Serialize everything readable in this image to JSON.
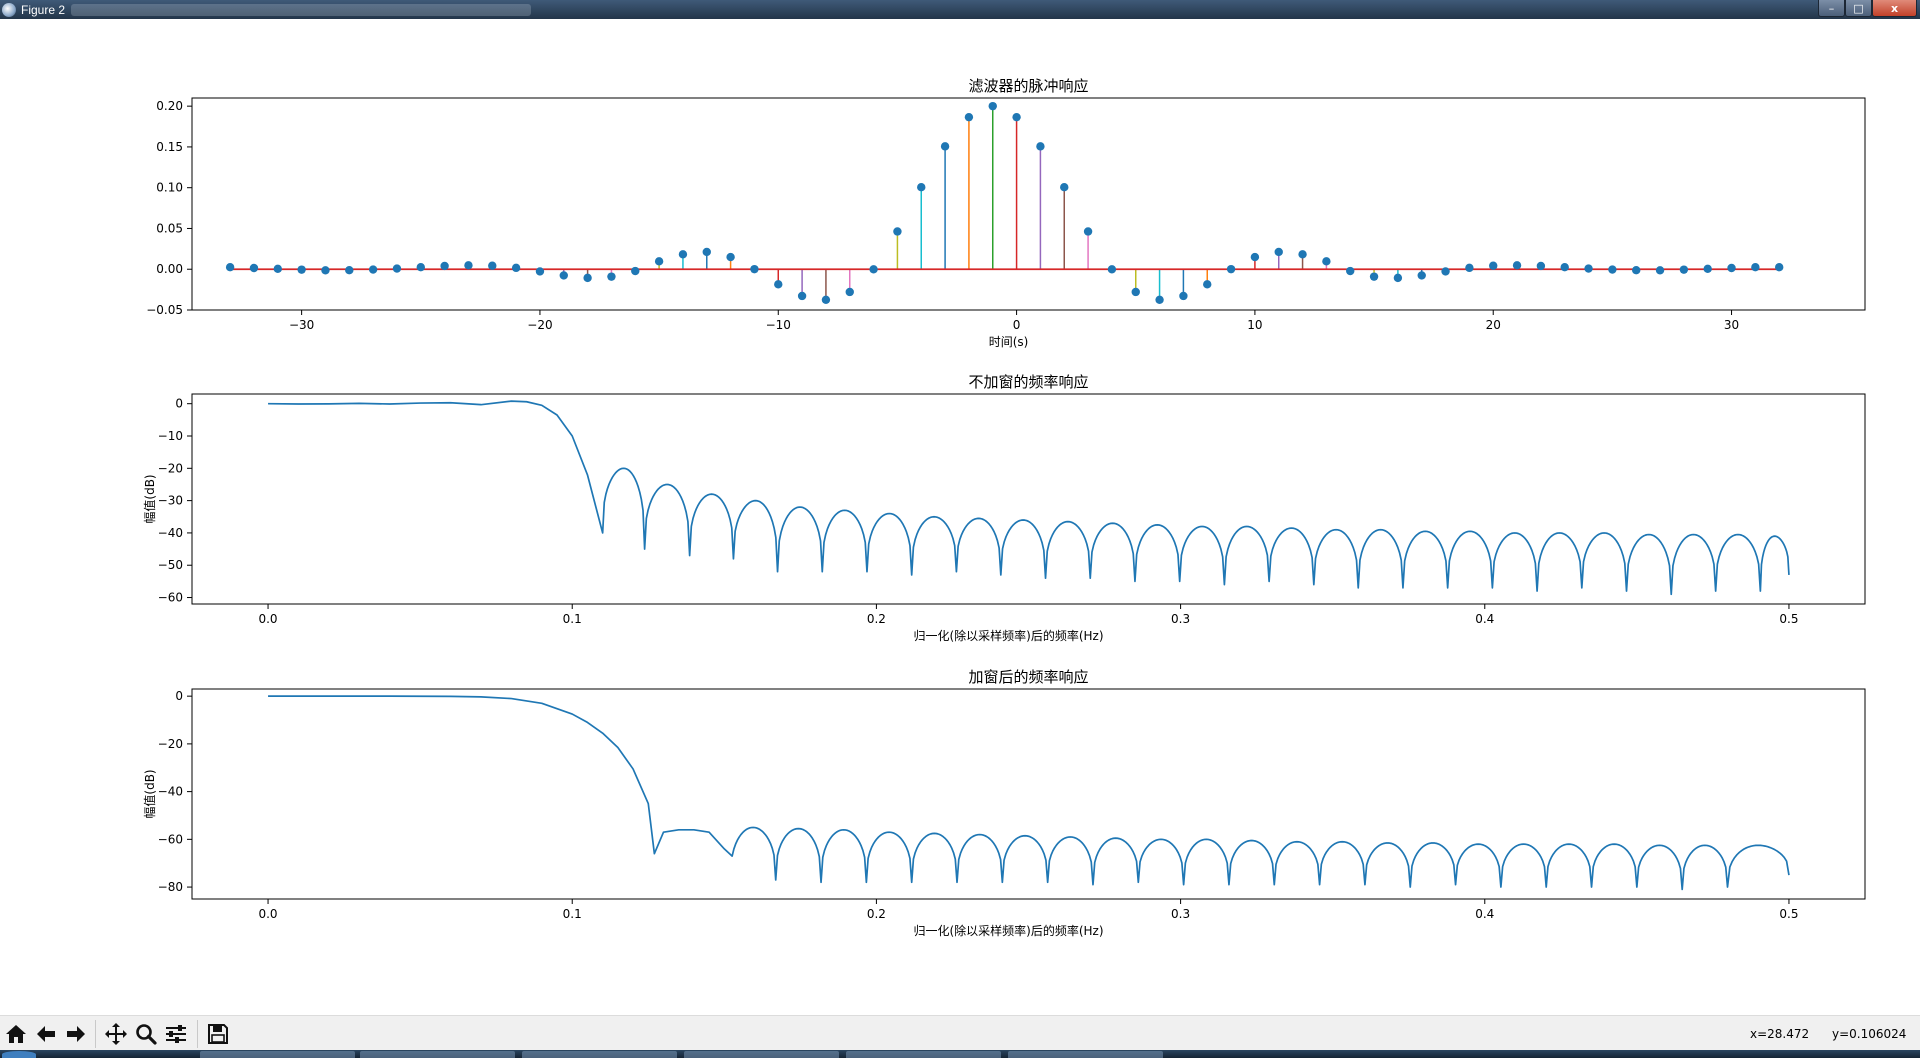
{
  "window": {
    "title": "Figure 2",
    "controls": {
      "minimize": "–",
      "maximize": "□",
      "close": "x"
    }
  },
  "colors": {
    "line": "#1f77b4",
    "marker": "#1f77b4",
    "baseline": "#d62728",
    "stem_cycle": [
      "#1f77b4",
      "#ff7f0e",
      "#2ca02c",
      "#d62728",
      "#9467bd",
      "#8c564b",
      "#e377c2",
      "#7f7f7f",
      "#bcbd22",
      "#17becf"
    ]
  },
  "chart_data": [
    {
      "type": "stem",
      "title": "滤波器的脉冲响应",
      "xlabel": "时间(s)",
      "ylabel": "",
      "xlim": [
        -34.6,
        35.6
      ],
      "ylim": [
        -0.05,
        0.21
      ],
      "xticks": [
        -30,
        -20,
        -10,
        0,
        10,
        20,
        30
      ],
      "xtick_labels": [
        "−30",
        "−20",
        "−10",
        "0",
        "10",
        "20",
        "30"
      ],
      "yticks": [
        -0.05,
        0.0,
        0.05,
        0.1,
        0.15,
        0.2
      ],
      "ytick_labels": [
        "−0.05",
        "0.00",
        "0.05",
        "0.10",
        "0.15",
        "0.20"
      ],
      "x_start": -33,
      "x_step": 1,
      "values": [
        0.0025,
        0.0015,
        0.0005,
        -0.0005,
        -0.0013,
        -0.0012,
        -0.0004,
        0.0008,
        0.0025,
        0.004,
        0.0048,
        0.0043,
        0.0017,
        -0.0027,
        -0.0076,
        -0.0106,
        -0.0091,
        -0.0022,
        0.0097,
        0.0183,
        0.0212,
        0.0149,
        0.0001,
        -0.0185,
        -0.0328,
        -0.0375,
        -0.0279,
        -0.0001,
        0.0463,
        0.1006,
        0.1507,
        0.1865,
        0.2,
        0.1865,
        0.1507,
        0.1006,
        0.0463,
        -0.0001,
        -0.0279,
        -0.0375,
        -0.0328,
        -0.0185,
        0.0001,
        0.0149,
        0.0212,
        0.0183,
        0.0097,
        -0.0022,
        -0.0091,
        -0.0106,
        -0.0076,
        -0.0027,
        0.0017,
        0.0043,
        0.0048,
        0.004,
        0.0025,
        0.0008,
        -0.0004,
        -0.0012,
        -0.0013,
        -0.0005,
        0.0005,
        0.0015,
        0.0025,
        0.0025
      ],
      "grid": false
    },
    {
      "type": "line",
      "title": "不加窗的频率响应",
      "xlabel": "归一化(除以采样频率)后的频率(Hz)",
      "ylabel": "幅值(dB)",
      "xlim": [
        -0.025,
        0.525
      ],
      "ylim": [
        -62,
        3
      ],
      "xticks": [
        0.0,
        0.1,
        0.2,
        0.3,
        0.4,
        0.5
      ],
      "xtick_labels": [
        "0.0",
        "0.1",
        "0.2",
        "0.3",
        "0.4",
        "0.5"
      ],
      "yticks": [
        0,
        -10,
        -20,
        -30,
        -40,
        -50,
        -60
      ],
      "ytick_labels": [
        "0",
        "−10",
        "−20",
        "−30",
        "−40",
        "−50",
        "−60"
      ],
      "passband": {
        "x": [
          0.0,
          0.01,
          0.02,
          0.03,
          0.04,
          0.05,
          0.06,
          0.07,
          0.08,
          0.085,
          0.09,
          0.095,
          0.1,
          0.105,
          0.11
        ],
        "y": [
          0.0,
          -0.1,
          -0.05,
          0.1,
          -0.1,
          0.2,
          0.3,
          -0.3,
          0.8,
          0.6,
          -0.5,
          -3.5,
          -10,
          -22,
          -40
        ]
      },
      "lobe_peaks": [
        -20,
        -25,
        -28,
        -30,
        -32,
        -33,
        -34,
        -35,
        -35.5,
        -36,
        -36.5,
        -37,
        -37.5,
        -38,
        -38,
        -38.5,
        -39,
        -39,
        -39.5,
        -39.5,
        -40,
        -40,
        -40,
        -40.5,
        -40.5,
        -40.5,
        -41,
        -41,
        -41
      ],
      "nulls_x": [
        0.11,
        0.1238,
        0.1386,
        0.153,
        0.1675,
        0.1822,
        0.1969,
        0.2116,
        0.2263,
        0.2409,
        0.2556,
        0.2703,
        0.285,
        0.2997,
        0.3144,
        0.3291,
        0.3438,
        0.3584,
        0.3731,
        0.3878,
        0.4025,
        0.4172,
        0.4319,
        0.4466,
        0.4613,
        0.4759,
        0.4906,
        0.5
      ],
      "nulls_y": [
        -40,
        -45,
        -47,
        -48,
        -52,
        -52,
        -52,
        -53,
        -52,
        -53,
        -54,
        -54,
        -55,
        -55,
        -56,
        -55,
        -56,
        -57,
        -57,
        -57,
        -57,
        -58,
        -57,
        -58,
        -59,
        -58,
        -58,
        -53
      ],
      "grid": false
    },
    {
      "type": "line",
      "title": "加窗后的频率响应",
      "xlabel": "归一化(除以采样频率)后的频率(Hz)",
      "ylabel": "幅值(dB)",
      "xlim": [
        -0.025,
        0.525
      ],
      "ylim": [
        -85,
        3
      ],
      "xticks": [
        0.0,
        0.1,
        0.2,
        0.3,
        0.4,
        0.5
      ],
      "xtick_labels": [
        "0.0",
        "0.1",
        "0.2",
        "0.3",
        "0.4",
        "0.5"
      ],
      "yticks": [
        0,
        -20,
        -40,
        -60,
        -80
      ],
      "ytick_labels": [
        "0",
        "−20",
        "−40",
        "−60",
        "−80"
      ],
      "passband": {
        "x": [
          0.0,
          0.04,
          0.06,
          0.07,
          0.08,
          0.09,
          0.1,
          0.105,
          0.11,
          0.115,
          0.12,
          0.125,
          0.127,
          0.13,
          0.135,
          0.14,
          0.145,
          0.15
        ],
        "y": [
          0.0,
          0.0,
          -0.1,
          -0.3,
          -1,
          -3,
          -7.5,
          -11,
          -15.5,
          -21.5,
          -30.5,
          -45,
          -66,
          -57,
          -56,
          -56,
          -57,
          -64
        ]
      },
      "lobe_peaks": [
        -55,
        -55.5,
        -56,
        -57,
        -57.5,
        -58,
        -58.5,
        -59,
        -59.5,
        -60,
        -60,
        -60.5,
        -61,
        -61,
        -61.5,
        -61.5,
        -62,
        -62,
        -62,
        -62,
        -62.5,
        -62.5,
        -62.5
      ],
      "nulls_x": [
        0.152,
        0.1669,
        0.1818,
        0.1967,
        0.2116,
        0.2265,
        0.2414,
        0.2563,
        0.2712,
        0.2861,
        0.301,
        0.3159,
        0.3308,
        0.3457,
        0.3606,
        0.3755,
        0.3904,
        0.4053,
        0.4202,
        0.4351,
        0.45,
        0.4649,
        0.4798,
        0.5
      ],
      "nulls_y": [
        -78,
        -77,
        -78,
        -78,
        -78,
        -78,
        -78,
        -78,
        -79,
        -78,
        -79,
        -79,
        -79,
        -79,
        -79,
        -80,
        -79,
        -80,
        -80,
        -80,
        -80,
        -81,
        -80,
        -75
      ],
      "grid": false
    }
  ],
  "toolbar": {
    "buttons": [
      {
        "name": "home-button",
        "icon": "home-icon"
      },
      {
        "name": "back-button",
        "icon": "arrow-left-icon"
      },
      {
        "name": "forward-button",
        "icon": "arrow-right-icon"
      },
      {
        "name": "pan-button",
        "icon": "move-icon"
      },
      {
        "name": "zoom-button",
        "icon": "magnifier-icon"
      },
      {
        "name": "configure-subplots-button",
        "icon": "sliders-icon"
      },
      {
        "name": "save-button",
        "icon": "floppy-icon"
      }
    ],
    "coord_x": "x=28.472",
    "coord_y": "y=0.106024"
  }
}
